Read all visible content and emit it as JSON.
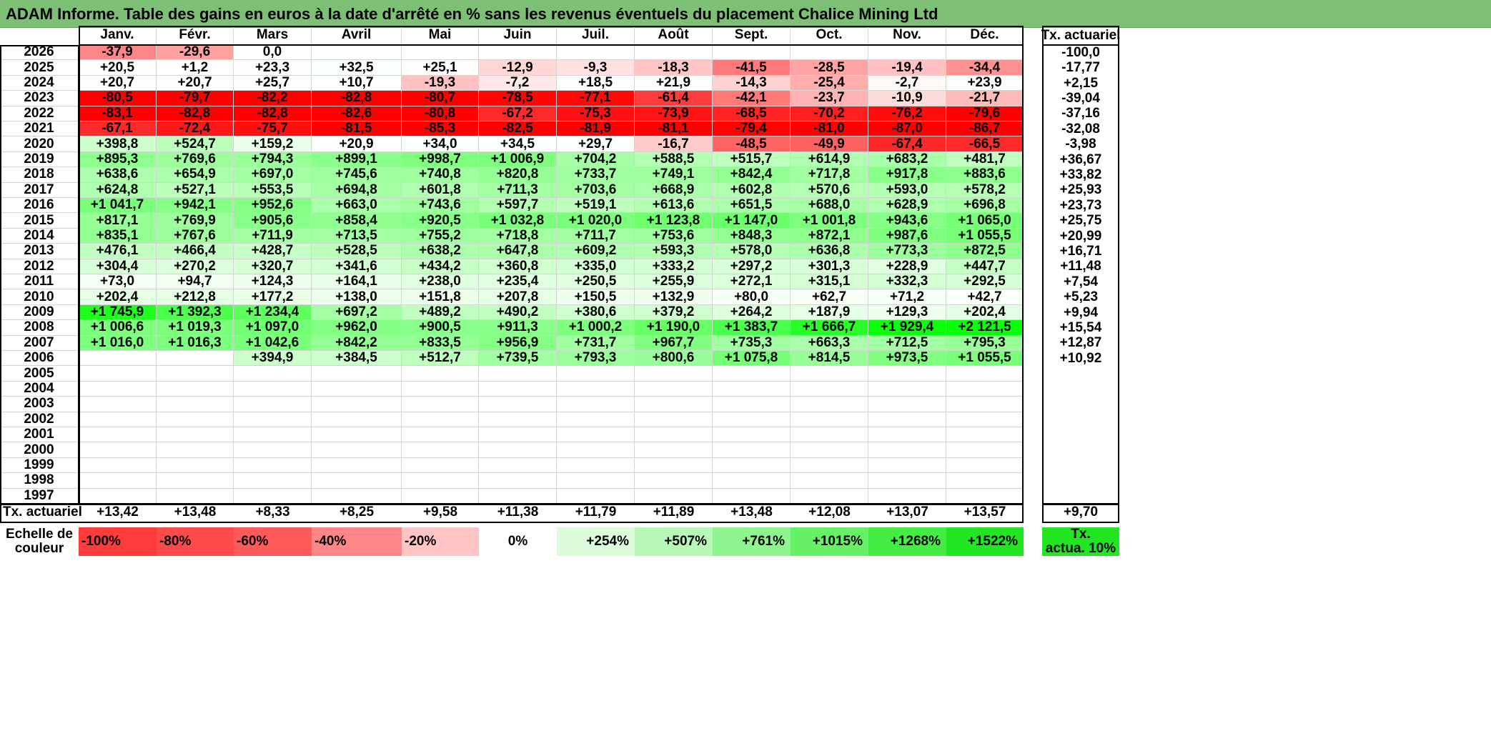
{
  "title": "ADAM Informe. Table des gains en euros à la date d'arrêté en % sans les revenus éventuels du placement Chalice Mining Ltd",
  "months": [
    "Janv.",
    "Févr.",
    "Mars",
    "Avril",
    "Mai",
    "Juin",
    "Juil.",
    "Août",
    "Sept.",
    "Oct.",
    "Nov.",
    "Déc."
  ],
  "tx_header": "Tx. actuariel",
  "rows": [
    {
      "year": "2026",
      "values": [
        "-37,9",
        "-29,6",
        "0,0",
        "",
        "",
        "",
        "",
        "",
        "",
        "",
        "",
        ""
      ],
      "tx": "-100,0"
    },
    {
      "year": "2025",
      "values": [
        "+20,5",
        "+1,2",
        "+23,3",
        "+32,5",
        "+25,1",
        "-12,9",
        "-9,3",
        "-18,3",
        "-41,5",
        "-28,5",
        "-19,4",
        "-34,4"
      ],
      "tx": "-17,77"
    },
    {
      "year": "2024",
      "values": [
        "+20,7",
        "+20,7",
        "+25,7",
        "+10,7",
        "-19,3",
        "-7,2",
        "+18,5",
        "+21,9",
        "-14,3",
        "-25,4",
        "-2,7",
        "+23,9"
      ],
      "tx": "+2,15"
    },
    {
      "year": "2023",
      "values": [
        "-80,5",
        "-79,7",
        "-82,2",
        "-82,8",
        "-80,7",
        "-78,5",
        "-77,1",
        "-61,4",
        "-42,1",
        "-23,7",
        "-10,9",
        "-21,7"
      ],
      "tx": "-39,04"
    },
    {
      "year": "2022",
      "values": [
        "-83,1",
        "-82,8",
        "-82,8",
        "-82,6",
        "-80,8",
        "-67,2",
        "-75,3",
        "-73,9",
        "-68,5",
        "-70,2",
        "-76,2",
        "-79,6"
      ],
      "tx": "-37,16"
    },
    {
      "year": "2021",
      "values": [
        "-67,1",
        "-72,4",
        "-75,7",
        "-81,5",
        "-85,3",
        "-82,5",
        "-81,9",
        "-81,1",
        "-79,4",
        "-81,0",
        "-87,0",
        "-86,7"
      ],
      "tx": "-32,08"
    },
    {
      "year": "2020",
      "values": [
        "+398,8",
        "+524,7",
        "+159,2",
        "+20,9",
        "+34,0",
        "+34,5",
        "+29,7",
        "-16,7",
        "-48,5",
        "-49,9",
        "-67,4",
        "-66,5"
      ],
      "tx": "-3,98"
    },
    {
      "year": "2019",
      "values": [
        "+895,3",
        "+769,6",
        "+794,3",
        "+899,1",
        "+998,7",
        "+1 006,9",
        "+704,2",
        "+588,5",
        "+515,7",
        "+614,9",
        "+683,2",
        "+481,7"
      ],
      "tx": "+36,67"
    },
    {
      "year": "2018",
      "values": [
        "+638,6",
        "+654,9",
        "+697,0",
        "+745,6",
        "+740,8",
        "+820,8",
        "+733,7",
        "+749,1",
        "+842,4",
        "+717,8",
        "+917,8",
        "+883,6"
      ],
      "tx": "+33,82"
    },
    {
      "year": "2017",
      "values": [
        "+624,8",
        "+527,1",
        "+553,5",
        "+694,8",
        "+601,8",
        "+711,3",
        "+703,6",
        "+668,9",
        "+602,8",
        "+570,6",
        "+593,0",
        "+578,2"
      ],
      "tx": "+25,93"
    },
    {
      "year": "2016",
      "values": [
        "+1 041,7",
        "+942,1",
        "+952,6",
        "+663,0",
        "+743,6",
        "+597,7",
        "+519,1",
        "+613,6",
        "+651,5",
        "+688,0",
        "+628,9",
        "+696,8"
      ],
      "tx": "+23,73"
    },
    {
      "year": "2015",
      "values": [
        "+817,1",
        "+769,9",
        "+905,6",
        "+858,4",
        "+920,5",
        "+1 032,8",
        "+1 020,0",
        "+1 123,8",
        "+1 147,0",
        "+1 001,8",
        "+943,6",
        "+1 065,0"
      ],
      "tx": "+25,75"
    },
    {
      "year": "2014",
      "values": [
        "+835,1",
        "+767,6",
        "+711,9",
        "+713,5",
        "+755,2",
        "+718,8",
        "+711,7",
        "+753,6",
        "+848,3",
        "+872,1",
        "+987,6",
        "+1 055,5"
      ],
      "tx": "+20,99"
    },
    {
      "year": "2013",
      "values": [
        "+476,1",
        "+466,4",
        "+428,7",
        "+528,5",
        "+638,2",
        "+647,8",
        "+609,2",
        "+593,3",
        "+578,0",
        "+636,8",
        "+773,3",
        "+872,5"
      ],
      "tx": "+16,71"
    },
    {
      "year": "2012",
      "values": [
        "+304,4",
        "+270,2",
        "+320,7",
        "+341,6",
        "+434,2",
        "+360,8",
        "+335,0",
        "+333,2",
        "+297,2",
        "+301,3",
        "+228,9",
        "+447,7"
      ],
      "tx": "+11,48"
    },
    {
      "year": "2011",
      "values": [
        "+73,0",
        "+94,7",
        "+124,3",
        "+164,1",
        "+238,0",
        "+235,4",
        "+250,5",
        "+255,9",
        "+272,1",
        "+315,1",
        "+332,3",
        "+292,5"
      ],
      "tx": "+7,54"
    },
    {
      "year": "2010",
      "values": [
        "+202,4",
        "+212,8",
        "+177,2",
        "+138,0",
        "+151,8",
        "+207,8",
        "+150,5",
        "+132,9",
        "+80,0",
        "+62,7",
        "+71,2",
        "+42,7"
      ],
      "tx": "+5,23"
    },
    {
      "year": "2009",
      "values": [
        "+1 745,9",
        "+1 392,3",
        "+1 234,4",
        "+697,2",
        "+489,2",
        "+490,2",
        "+380,6",
        "+379,2",
        "+264,2",
        "+187,9",
        "+129,3",
        "+202,4"
      ],
      "tx": "+9,94"
    },
    {
      "year": "2008",
      "values": [
        "+1 006,6",
        "+1 019,3",
        "+1 097,0",
        "+962,0",
        "+900,5",
        "+911,3",
        "+1 000,2",
        "+1 190,0",
        "+1 383,7",
        "+1 666,7",
        "+1 929,4",
        "+2 121,5"
      ],
      "tx": "+15,54"
    },
    {
      "year": "2007",
      "values": [
        "+1 016,0",
        "+1 016,3",
        "+1 042,6",
        "+842,2",
        "+833,5",
        "+956,9",
        "+731,7",
        "+967,7",
        "+735,3",
        "+663,3",
        "+712,5",
        "+795,3"
      ],
      "tx": "+12,87"
    },
    {
      "year": "2006",
      "values": [
        "",
        "",
        "+394,9",
        "+384,5",
        "+512,7",
        "+739,5",
        "+793,3",
        "+800,6",
        "+1 075,8",
        "+814,5",
        "+973,5",
        "+1 055,5"
      ],
      "tx": "+10,92"
    },
    {
      "year": "2005",
      "values": [
        "",
        "",
        "",
        "",
        "",
        "",
        "",
        "",
        "",
        "",
        "",
        ""
      ],
      "tx": ""
    },
    {
      "year": "2004",
      "values": [
        "",
        "",
        "",
        "",
        "",
        "",
        "",
        "",
        "",
        "",
        "",
        ""
      ],
      "tx": ""
    },
    {
      "year": "2003",
      "values": [
        "",
        "",
        "",
        "",
        "",
        "",
        "",
        "",
        "",
        "",
        "",
        ""
      ],
      "tx": ""
    },
    {
      "year": "2002",
      "values": [
        "",
        "",
        "",
        "",
        "",
        "",
        "",
        "",
        "",
        "",
        "",
        ""
      ],
      "tx": ""
    },
    {
      "year": "2001",
      "values": [
        "",
        "",
        "",
        "",
        "",
        "",
        "",
        "",
        "",
        "",
        "",
        ""
      ],
      "tx": ""
    },
    {
      "year": "2000",
      "values": [
        "",
        "",
        "",
        "",
        "",
        "",
        "",
        "",
        "",
        "",
        "",
        ""
      ],
      "tx": ""
    },
    {
      "year": "1999",
      "values": [
        "",
        "",
        "",
        "",
        "",
        "",
        "",
        "",
        "",
        "",
        "",
        ""
      ],
      "tx": ""
    },
    {
      "year": "1998",
      "values": [
        "",
        "",
        "",
        "",
        "",
        "",
        "",
        "",
        "",
        "",
        "",
        ""
      ],
      "tx": ""
    },
    {
      "year": "1997",
      "values": [
        "",
        "",
        "",
        "",
        "",
        "",
        "",
        "",
        "",
        "",
        "",
        ""
      ],
      "tx": ""
    }
  ],
  "footer": {
    "label": "Tx. actuariel",
    "values": [
      "+13,42",
      "+13,48",
      "+8,33",
      "+8,25",
      "+9,58",
      "+11,38",
      "+11,79",
      "+11,89",
      "+13,48",
      "+12,08",
      "+13,07",
      "+13,57"
    ],
    "total": "+9,70"
  },
  "legend": {
    "label_line1": "Echelle de",
    "label_line2": "couleur",
    "items": [
      {
        "text": "-100%",
        "color": "#ff3b3b"
      },
      {
        "text": "-80%",
        "color": "#ff4a4a"
      },
      {
        "text": "-60%",
        "color": "#ff5a5a"
      },
      {
        "text": "-40%",
        "color": "#ff8686"
      },
      {
        "text": "-20%",
        "color": "#ffc4c4"
      },
      {
        "text": "0%",
        "color": "#ffffff"
      },
      {
        "text": "+254%",
        "color": "#dcfcdc"
      },
      {
        "text": "+507%",
        "color": "#b7f8b7"
      },
      {
        "text": "+761%",
        "color": "#8ef58e"
      },
      {
        "text": "+1015%",
        "color": "#66f066"
      },
      {
        "text": "+1268%",
        "color": "#44ec44"
      },
      {
        "text": "+1522%",
        "color": "#22e622"
      }
    ],
    "tx_line1": "Tx.",
    "tx_line2": "actua. 10%",
    "tx_color": "#22e622"
  },
  "colors": {
    "title_bg": "#7dbf74",
    "negative_max": "#ff0000",
    "positive_max": "#00ff00"
  }
}
